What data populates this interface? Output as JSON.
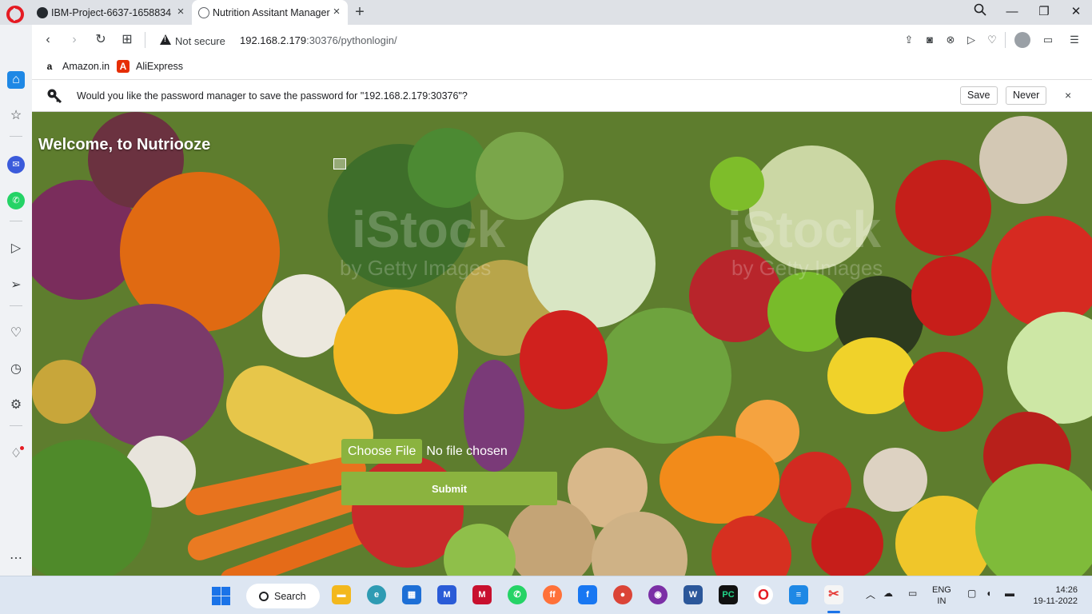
{
  "browser": {
    "tabs": [
      {
        "label": "IBM-Project-6637-1658834",
        "icon": "github-icon"
      },
      {
        "label": "Nutrition Assitant Manager",
        "icon": "globe-icon"
      }
    ],
    "address": {
      "security_label": "Not secure",
      "url_host": "192.168.2.179",
      "url_rest": ":30376/pythonlogin/"
    },
    "bookmarks": [
      {
        "label": "Amazon.in",
        "icon": "a"
      },
      {
        "label": "AliExpress",
        "icon": "A"
      }
    ],
    "password_prompt": {
      "message": "Would you like the password manager to save the password for \"192.168.2.179:30376\"?",
      "save_label": "Save",
      "never_label": "Never",
      "close_glyph": "×"
    }
  },
  "page": {
    "welcome": "Welcome, to Nutriooze",
    "choose_file_label": "Choose File",
    "file_status": "No file chosen",
    "submit_label": "Submit",
    "watermark_text": "iStock",
    "watermark_sub": "by Getty Images"
  },
  "taskbar": {
    "search_label": "Search",
    "language_line1": "ENG",
    "language_line2": "IN",
    "time": "14:26",
    "date": "19-11-2022"
  },
  "colors": {
    "accent_green": "#8bb33f",
    "opera_red": "#e51b23",
    "sidebar_active_blue": "#1e88e5"
  }
}
